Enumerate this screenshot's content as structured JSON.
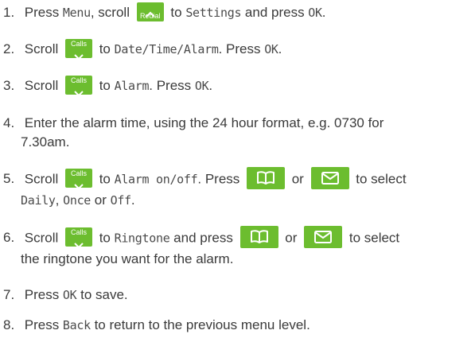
{
  "steps": [
    {
      "num": "1.",
      "parts": {
        "a": "Press ",
        "b": "Menu",
        "c": ", scroll ",
        "key": "Redial",
        "d": " to ",
        "e": "Settings",
        "f": " and press ",
        "g": "OK",
        "h": "."
      }
    },
    {
      "num": "2.",
      "parts": {
        "a": "Scroll ",
        "key": "Calls",
        "b": " to ",
        "c": "Date/Time/Alarm",
        "d": ". Press ",
        "e": "OK",
        "f": "."
      }
    },
    {
      "num": "3.",
      "parts": {
        "a": "Scroll ",
        "key": "Calls",
        "b": " to ",
        "c": "Alarm",
        "d": ". Press ",
        "e": "OK",
        "f": "."
      }
    },
    {
      "num": "4.",
      "parts": {
        "a": "Enter the alarm time, using the 24 hour format, e.g. 0730 for",
        "b": "7.30am."
      }
    },
    {
      "num": "5.",
      "parts": {
        "a": "Scroll ",
        "key": "Calls",
        "b": " to ",
        "c": "Alarm on/off",
        "d": ". Press ",
        "e": " or ",
        "f": " to select",
        "g": "Daily",
        "h": ", ",
        "i": "Once",
        "j": " or ",
        "k": "Off",
        "l": "."
      }
    },
    {
      "num": "6.",
      "parts": {
        "a": "Scroll ",
        "key": "Calls",
        "b": " to ",
        "c": "Ringtone",
        "d": " and press ",
        "e": " or ",
        "f": " to select",
        "g": "the ringtone you want for the alarm."
      }
    },
    {
      "num": "7.",
      "parts": {
        "a": "Press ",
        "b": "OK",
        "c": " to save."
      }
    },
    {
      "num": "8.",
      "parts": {
        "a": "Press ",
        "b": "Back",
        "c": " to return to the previous menu level."
      }
    }
  ],
  "colors": {
    "key_green": "#6cbd2f",
    "text": "#3a3a3a"
  },
  "icons": {
    "redial_key": "chevron-up-icon",
    "calls_key": "chevron-down-icon",
    "phonebook_key": "book-icon",
    "messages_key": "envelope-icon"
  }
}
